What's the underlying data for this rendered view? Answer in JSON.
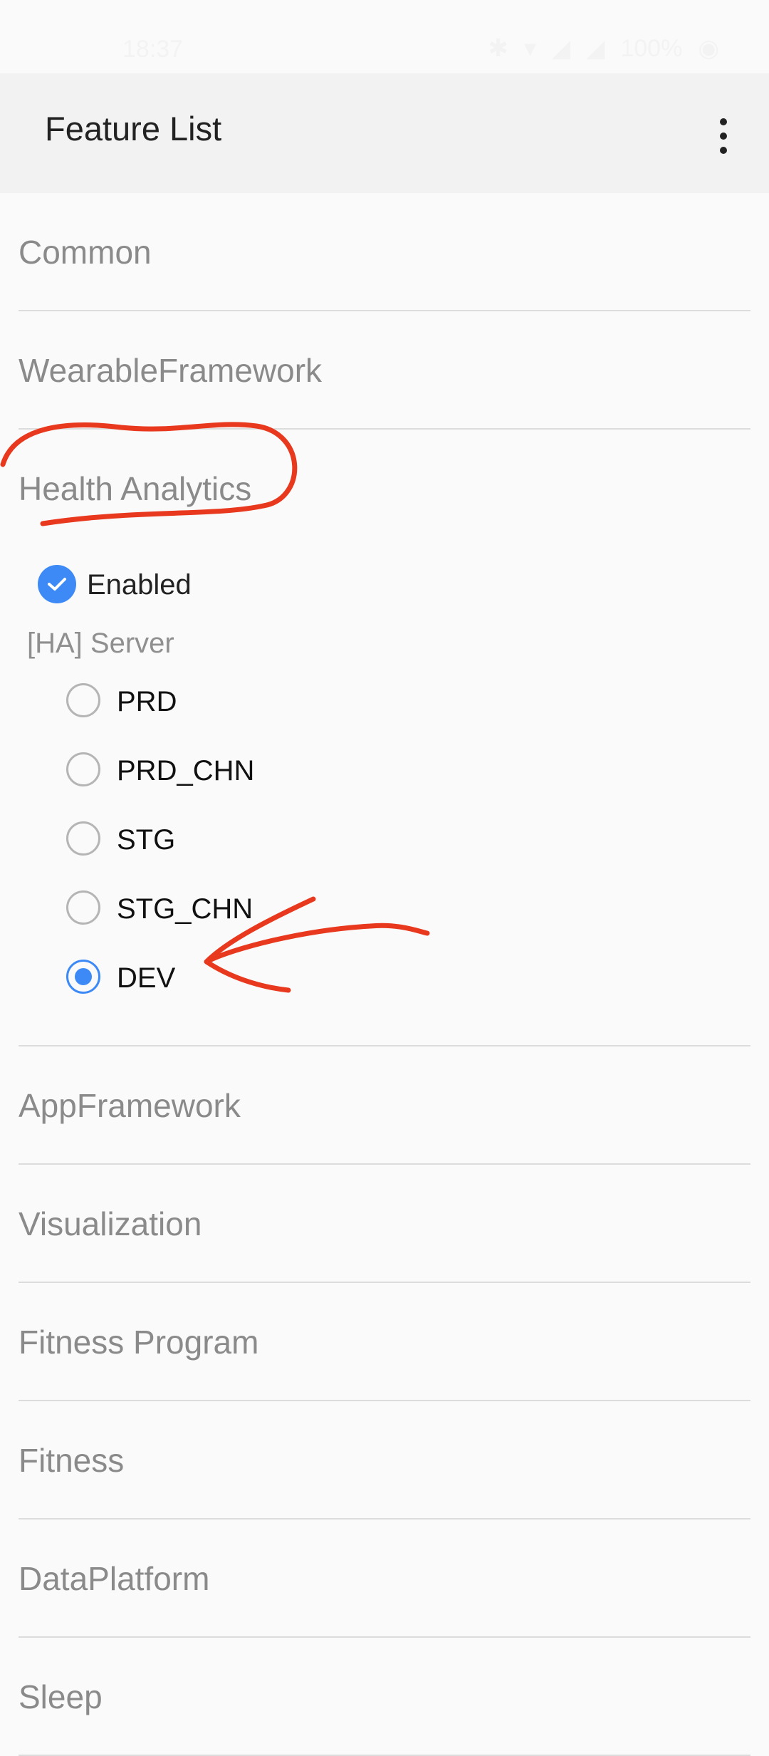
{
  "status_bar": {
    "time": "18:37",
    "battery": "100%"
  },
  "app_bar": {
    "title": "Feature List"
  },
  "sections": [
    {
      "label": "Common"
    },
    {
      "label": "WearableFramework"
    },
    {
      "label": "Health Analytics"
    },
    {
      "label": "AppFramework"
    },
    {
      "label": "Visualization"
    },
    {
      "label": "Fitness Program"
    },
    {
      "label": "Fitness"
    },
    {
      "label": "DataPlatform"
    },
    {
      "label": "Sleep"
    }
  ],
  "health_analytics": {
    "enabled_label": "Enabled",
    "enabled_checked": true,
    "server_label": "[HA] Server",
    "server_options": [
      "PRD",
      "PRD_CHN",
      "STG",
      "STG_CHN",
      "DEV"
    ],
    "selected_server": "DEV"
  },
  "colors": {
    "accent": "#3d8af7",
    "annotation": "#e8391f"
  }
}
